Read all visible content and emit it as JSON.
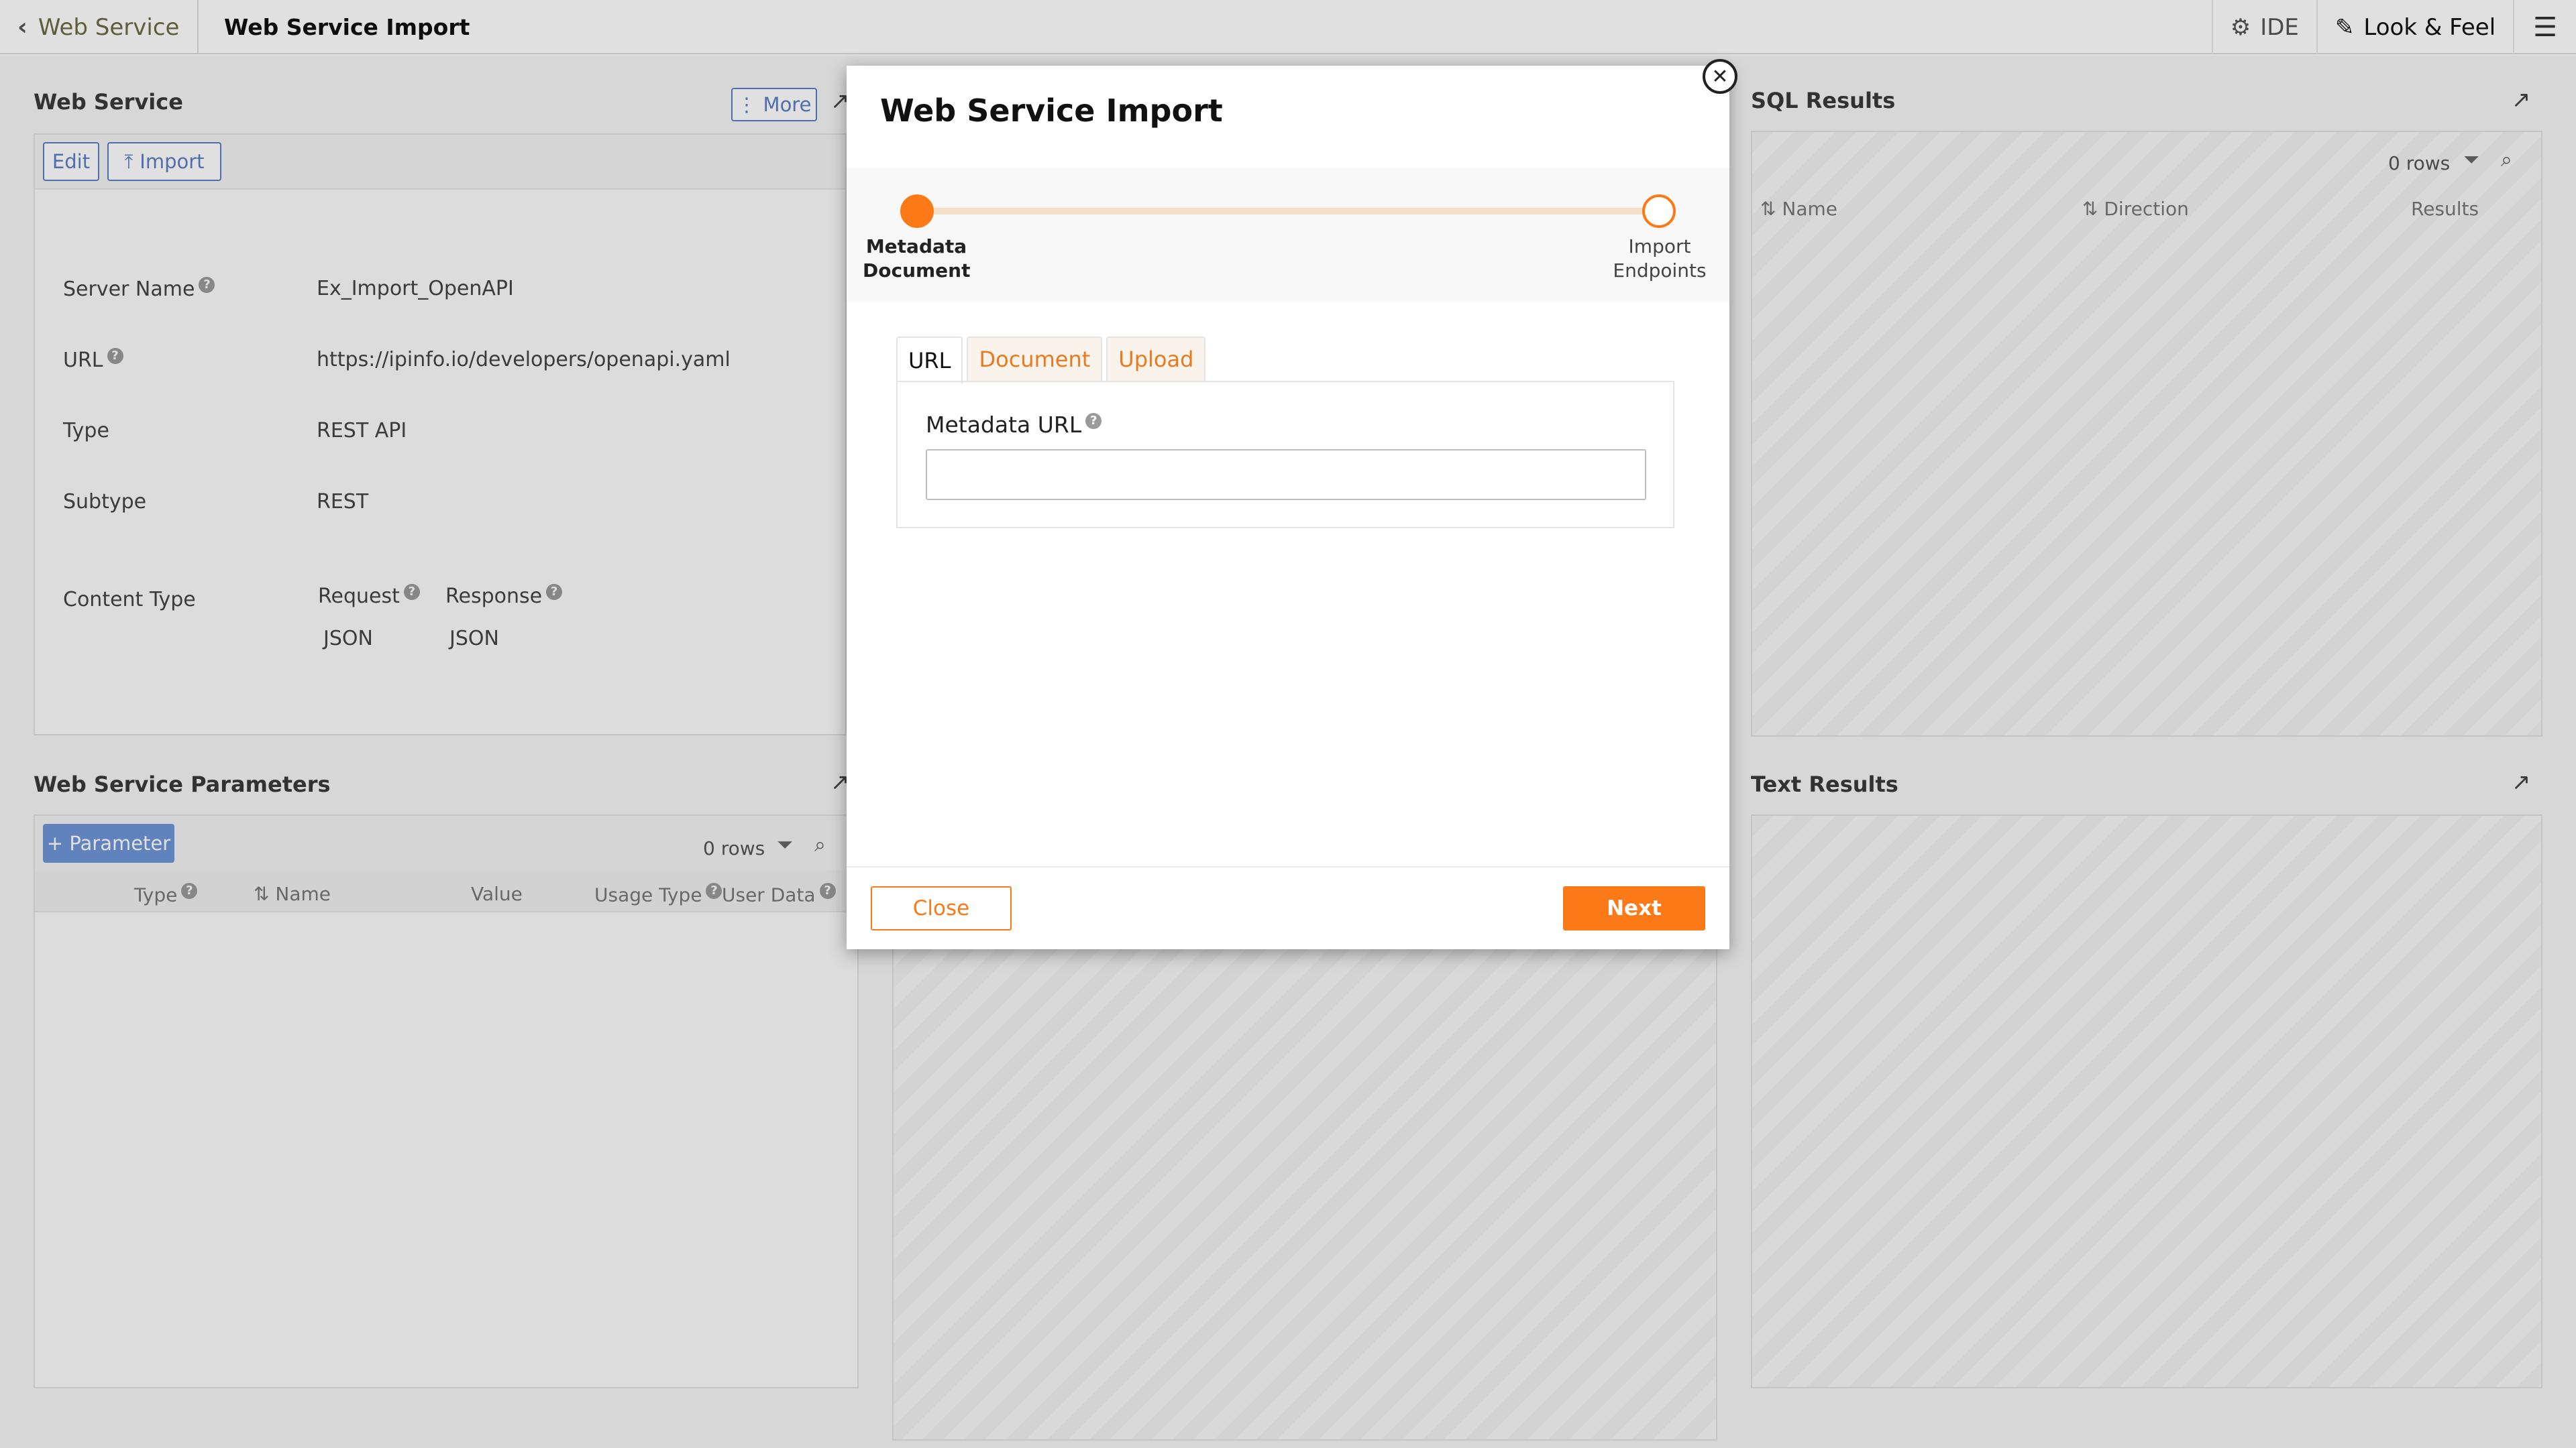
{
  "topbar": {
    "back_label": "Web Service",
    "page_title": "Web Service Import",
    "ide_label": "IDE",
    "look_feel_label": "Look & Feel"
  },
  "web_service": {
    "title": "Web Service",
    "more_label": "More",
    "edit_label": "Edit",
    "import_label": "Import",
    "fields": [
      {
        "label": "Server Name",
        "value": "Ex_Import_OpenAPI"
      },
      {
        "label": "URL",
        "value": "https://ipinfo.io/developers/openapi.yaml"
      },
      {
        "label": "Type",
        "value": "REST API"
      },
      {
        "label": "Subtype",
        "value": "REST"
      }
    ],
    "content_type_label": "Content Type",
    "request_label": "Request",
    "response_label": "Response",
    "request_value": "JSON",
    "response_value": "JSON"
  },
  "parameters": {
    "title": "Web Service Parameters",
    "add_label": "+ Parameter",
    "rows_label": "0 rows",
    "columns": [
      "Type",
      "Name",
      "Value",
      "Usage Type",
      "User Data"
    ]
  },
  "sql_results": {
    "title": "SQL Results",
    "rows_label": "0 rows",
    "columns": [
      "Name",
      "Direction",
      "Results"
    ]
  },
  "text_results": {
    "title": "Text Results"
  },
  "modal": {
    "title": "Web Service Import",
    "step1_line1": "Metadata",
    "step1_line2": "Document",
    "step2_line1": "Import",
    "step2_line2": "Endpoints",
    "tabs": [
      "URL",
      "Document",
      "Upload"
    ],
    "field_label": "Metadata URL",
    "field_value": "",
    "close_label": "Close",
    "next_label": "Next"
  },
  "colors": {
    "accent": "#fb7a17",
    "link_blue": "#5a7ec6",
    "param_button": "#6f96d8"
  }
}
